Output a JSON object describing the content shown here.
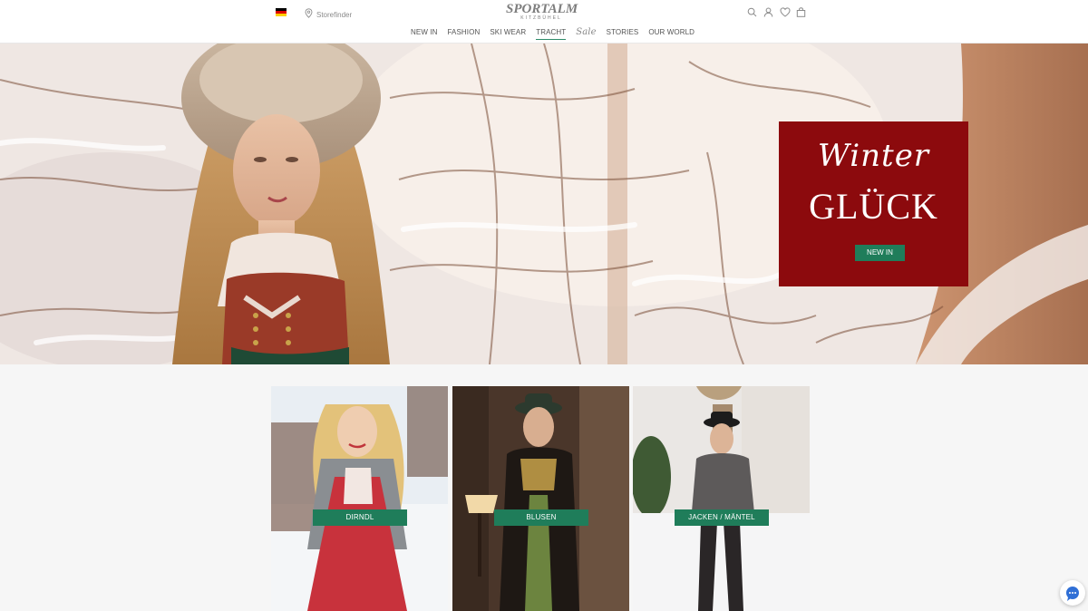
{
  "header": {
    "storefinder_label": "Storefinder",
    "logo_main": "SPORTALM",
    "logo_sub": "KITZBÜHEL",
    "icons": [
      "search-icon",
      "user-icon",
      "heart-icon",
      "bag-icon"
    ]
  },
  "nav": {
    "items": [
      "NEW IN",
      "FASHION",
      "SKI WEAR",
      "TRACHT"
    ],
    "sale_label": "Sale",
    "items_after": [
      "STORIES",
      "OUR WORLD"
    ],
    "active_item": "TRACHT"
  },
  "hero": {
    "script_text": "Winter",
    "title": "GLÜCK",
    "button_label": "NEW IN"
  },
  "categories": [
    {
      "label": "DIRNDL"
    },
    {
      "label": "BLUSEN"
    },
    {
      "label": "JACKEN / MÄNTEL"
    }
  ],
  "colors": {
    "accent_green": "#1f7d5a",
    "hero_panel_red": "#8c0a0d"
  }
}
